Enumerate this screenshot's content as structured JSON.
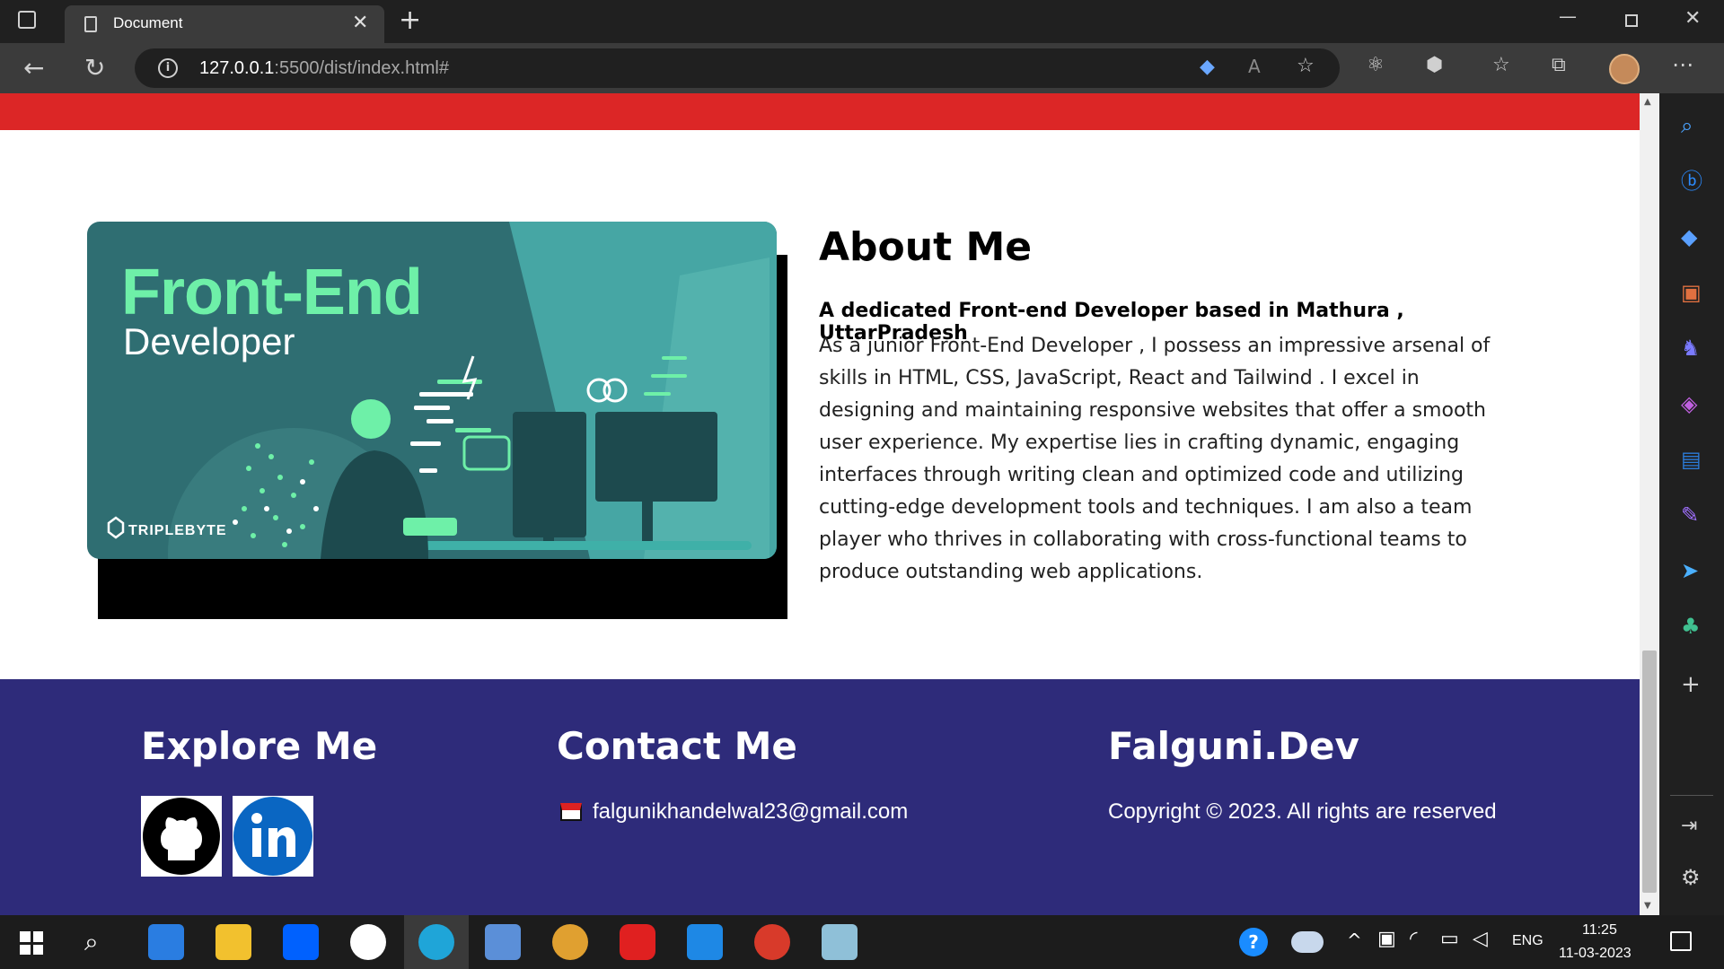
{
  "browser": {
    "tab_title": "Document",
    "url_host": "127.0.0.1",
    "url_path": ":5500/dist/index.html#"
  },
  "banner": {
    "title": "Front-End",
    "subtitle": "Developer",
    "brand": "TRIPLEBYTE"
  },
  "about": {
    "title": "About Me",
    "subtitle": "A dedicated Front-end Developer based in Mathura , UttarPradesh",
    "body": "As a junior Front-End Developer , I possess an impressive arsenal of skills in HTML, CSS, JavaScript, React and Tailwind . I excel in designing and maintaining responsive websites that offer a smooth user experience. My expertise lies in crafting dynamic, engaging interfaces through writing clean and optimized code and utilizing cutting-edge development tools and techniques. I am also a team player who thrives in collaborating with cross-functional teams to produce outstanding web applications."
  },
  "footer": {
    "explore_title": "Explore Me",
    "contact_title": "Contact Me",
    "email": "falgunikhandelwal23@gmail.com",
    "brand": "Falguni.Dev",
    "copyright": "Copyright © 2023. All rights are reserved"
  },
  "taskbar": {
    "lang": "ENG",
    "time": "11:25",
    "date": "11-03-2023"
  },
  "colors": {
    "accent_red": "#dc2626",
    "footer_bg": "#2e2b7a",
    "banner_green": "#6ef0a8"
  }
}
